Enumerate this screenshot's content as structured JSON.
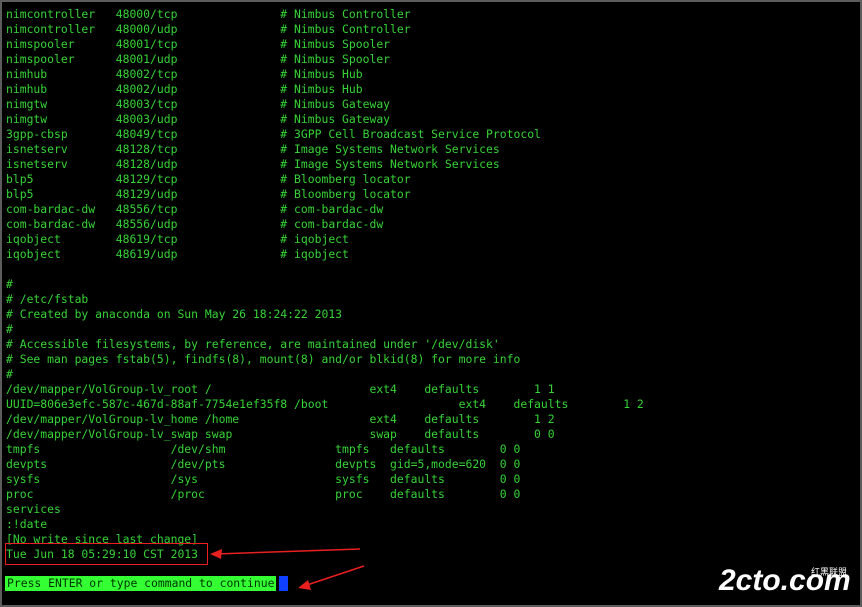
{
  "terminal": {
    "lines": [
      "nimcontroller   48000/tcp               # Nimbus Controller",
      "nimcontroller   48000/udp               # Nimbus Controller",
      "nimspooler      48001/tcp               # Nimbus Spooler",
      "nimspooler      48001/udp               # Nimbus Spooler",
      "nimhub          48002/tcp               # Nimbus Hub",
      "nimhub          48002/udp               # Nimbus Hub",
      "nimgtw          48003/tcp               # Nimbus Gateway",
      "nimgtw          48003/udp               # Nimbus Gateway",
      "3gpp-cbsp       48049/tcp               # 3GPP Cell Broadcast Service Protocol",
      "isnetserv       48128/tcp               # Image Systems Network Services",
      "isnetserv       48128/udp               # Image Systems Network Services",
      "blp5            48129/tcp               # Bloomberg locator",
      "blp5            48129/udp               # Bloomberg locator",
      "com-bardac-dw   48556/tcp               # com-bardac-dw",
      "com-bardac-dw   48556/udp               # com-bardac-dw",
      "iqobject        48619/tcp               # iqobject",
      "iqobject        48619/udp               # iqobject",
      "",
      "#",
      "# /etc/fstab",
      "# Created by anaconda on Sun May 26 18:24:22 2013",
      "#",
      "# Accessible filesystems, by reference, are maintained under '/dev/disk'",
      "# See man pages fstab(5), findfs(8), mount(8) and/or blkid(8) for more info",
      "#",
      "/dev/mapper/VolGroup-lv_root /                       ext4    defaults        1 1",
      "UUID=806e3efc-587c-467d-88af-7754e1ef35f8 /boot                   ext4    defaults        1 2",
      "/dev/mapper/VolGroup-lv_home /home                   ext4    defaults        1 2",
      "/dev/mapper/VolGroup-lv_swap swap                    swap    defaults        0 0",
      "tmpfs                   /dev/shm                tmpfs   defaults        0 0",
      "devpts                  /dev/pts                devpts  gid=5,mode=620  0 0",
      "sysfs                   /sys                    sysfs   defaults        0 0",
      "proc                    /proc                   proc    defaults        0 0",
      "services",
      ":!date",
      "[No write since last change]",
      "Tue Jun 18 05:29:10 CST 2013"
    ],
    "prompt": "Press ENTER or type command to continue"
  },
  "watermark": {
    "text": "2cto.com",
    "sub": "红黑联盟"
  },
  "colors": {
    "terminal_text": "#36d336",
    "background": "#000000",
    "prompt_bg": "#33ff33",
    "cursor": "#1040ff",
    "annotation": "#e82020"
  }
}
